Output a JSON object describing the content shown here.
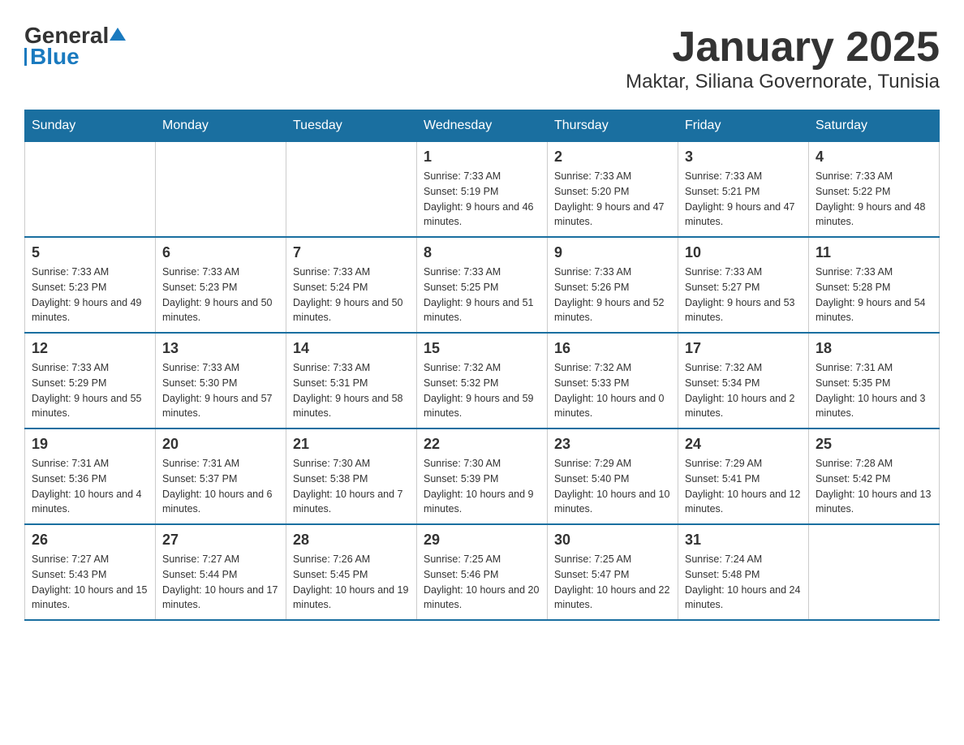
{
  "header": {
    "logo_text_black": "General",
    "logo_text_blue": "Blue",
    "title": "January 2025",
    "subtitle": "Maktar, Siliana Governorate, Tunisia"
  },
  "calendar": {
    "days_of_week": [
      "Sunday",
      "Monday",
      "Tuesday",
      "Wednesday",
      "Thursday",
      "Friday",
      "Saturday"
    ],
    "weeks": [
      [
        {
          "day": "",
          "info": ""
        },
        {
          "day": "",
          "info": ""
        },
        {
          "day": "",
          "info": ""
        },
        {
          "day": "1",
          "info": "Sunrise: 7:33 AM\nSunset: 5:19 PM\nDaylight: 9 hours and 46 minutes."
        },
        {
          "day": "2",
          "info": "Sunrise: 7:33 AM\nSunset: 5:20 PM\nDaylight: 9 hours and 47 minutes."
        },
        {
          "day": "3",
          "info": "Sunrise: 7:33 AM\nSunset: 5:21 PM\nDaylight: 9 hours and 47 minutes."
        },
        {
          "day": "4",
          "info": "Sunrise: 7:33 AM\nSunset: 5:22 PM\nDaylight: 9 hours and 48 minutes."
        }
      ],
      [
        {
          "day": "5",
          "info": "Sunrise: 7:33 AM\nSunset: 5:23 PM\nDaylight: 9 hours and 49 minutes."
        },
        {
          "day": "6",
          "info": "Sunrise: 7:33 AM\nSunset: 5:23 PM\nDaylight: 9 hours and 50 minutes."
        },
        {
          "day": "7",
          "info": "Sunrise: 7:33 AM\nSunset: 5:24 PM\nDaylight: 9 hours and 50 minutes."
        },
        {
          "day": "8",
          "info": "Sunrise: 7:33 AM\nSunset: 5:25 PM\nDaylight: 9 hours and 51 minutes."
        },
        {
          "day": "9",
          "info": "Sunrise: 7:33 AM\nSunset: 5:26 PM\nDaylight: 9 hours and 52 minutes."
        },
        {
          "day": "10",
          "info": "Sunrise: 7:33 AM\nSunset: 5:27 PM\nDaylight: 9 hours and 53 minutes."
        },
        {
          "day": "11",
          "info": "Sunrise: 7:33 AM\nSunset: 5:28 PM\nDaylight: 9 hours and 54 minutes."
        }
      ],
      [
        {
          "day": "12",
          "info": "Sunrise: 7:33 AM\nSunset: 5:29 PM\nDaylight: 9 hours and 55 minutes."
        },
        {
          "day": "13",
          "info": "Sunrise: 7:33 AM\nSunset: 5:30 PM\nDaylight: 9 hours and 57 minutes."
        },
        {
          "day": "14",
          "info": "Sunrise: 7:33 AM\nSunset: 5:31 PM\nDaylight: 9 hours and 58 minutes."
        },
        {
          "day": "15",
          "info": "Sunrise: 7:32 AM\nSunset: 5:32 PM\nDaylight: 9 hours and 59 minutes."
        },
        {
          "day": "16",
          "info": "Sunrise: 7:32 AM\nSunset: 5:33 PM\nDaylight: 10 hours and 0 minutes."
        },
        {
          "day": "17",
          "info": "Sunrise: 7:32 AM\nSunset: 5:34 PM\nDaylight: 10 hours and 2 minutes."
        },
        {
          "day": "18",
          "info": "Sunrise: 7:31 AM\nSunset: 5:35 PM\nDaylight: 10 hours and 3 minutes."
        }
      ],
      [
        {
          "day": "19",
          "info": "Sunrise: 7:31 AM\nSunset: 5:36 PM\nDaylight: 10 hours and 4 minutes."
        },
        {
          "day": "20",
          "info": "Sunrise: 7:31 AM\nSunset: 5:37 PM\nDaylight: 10 hours and 6 minutes."
        },
        {
          "day": "21",
          "info": "Sunrise: 7:30 AM\nSunset: 5:38 PM\nDaylight: 10 hours and 7 minutes."
        },
        {
          "day": "22",
          "info": "Sunrise: 7:30 AM\nSunset: 5:39 PM\nDaylight: 10 hours and 9 minutes."
        },
        {
          "day": "23",
          "info": "Sunrise: 7:29 AM\nSunset: 5:40 PM\nDaylight: 10 hours and 10 minutes."
        },
        {
          "day": "24",
          "info": "Sunrise: 7:29 AM\nSunset: 5:41 PM\nDaylight: 10 hours and 12 minutes."
        },
        {
          "day": "25",
          "info": "Sunrise: 7:28 AM\nSunset: 5:42 PM\nDaylight: 10 hours and 13 minutes."
        }
      ],
      [
        {
          "day": "26",
          "info": "Sunrise: 7:27 AM\nSunset: 5:43 PM\nDaylight: 10 hours and 15 minutes."
        },
        {
          "day": "27",
          "info": "Sunrise: 7:27 AM\nSunset: 5:44 PM\nDaylight: 10 hours and 17 minutes."
        },
        {
          "day": "28",
          "info": "Sunrise: 7:26 AM\nSunset: 5:45 PM\nDaylight: 10 hours and 19 minutes."
        },
        {
          "day": "29",
          "info": "Sunrise: 7:25 AM\nSunset: 5:46 PM\nDaylight: 10 hours and 20 minutes."
        },
        {
          "day": "30",
          "info": "Sunrise: 7:25 AM\nSunset: 5:47 PM\nDaylight: 10 hours and 22 minutes."
        },
        {
          "day": "31",
          "info": "Sunrise: 7:24 AM\nSunset: 5:48 PM\nDaylight: 10 hours and 24 minutes."
        },
        {
          "day": "",
          "info": ""
        }
      ]
    ]
  }
}
